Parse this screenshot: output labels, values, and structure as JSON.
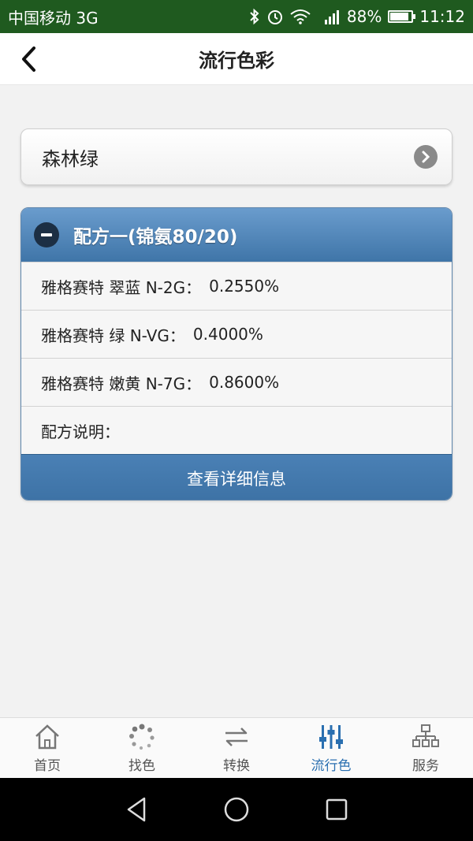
{
  "statusbar": {
    "carrier": "中国移动 3G",
    "battery": "88%",
    "time": "11:12",
    "network": "3G"
  },
  "navbar": {
    "title": "流行色彩"
  },
  "color_selector": {
    "label": "森林绿"
  },
  "formula": {
    "title": "配方一(锦氨80/20)",
    "items": [
      {
        "name": "雅格赛特 翠蓝 N-2G：",
        "value": "0.2550%"
      },
      {
        "name": "雅格赛特 绿 N-VG：",
        "value": "0.4000%"
      },
      {
        "name": "雅格赛特 嫩黄 N-7G：",
        "value": "0.8600%"
      }
    ],
    "note_label": "配方说明：",
    "detail_button": "查看详细信息"
  },
  "tabs": [
    {
      "label": "首页",
      "icon": "home-icon"
    },
    {
      "label": "找色",
      "icon": "dots-circle-icon"
    },
    {
      "label": "转换",
      "icon": "swap-icon"
    },
    {
      "label": "流行色",
      "icon": "equalizer-icon",
      "active": true
    },
    {
      "label": "服务",
      "icon": "network-icon"
    }
  ],
  "colors": {
    "status_bg": "#1f5a1f",
    "header_blue": "#4a80b5",
    "active_tab": "#2a6fb0"
  }
}
